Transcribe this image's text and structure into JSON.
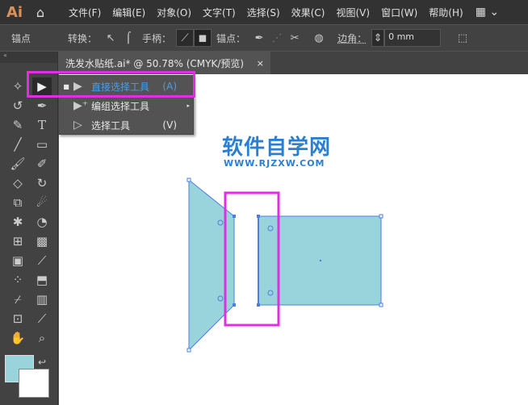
{
  "app": {
    "logo": "Ai"
  },
  "menu": [
    "文件(F)",
    "编辑(E)",
    "对象(O)",
    "文字(T)",
    "选择(S)",
    "效果(C)",
    "视图(V)",
    "窗口(W)",
    "帮助(H)"
  ],
  "control": {
    "anchor_label": "锚点",
    "convert_label": "转换：",
    "handles_label": "手柄：",
    "anchors_label": "锚点：",
    "corner_label": "边角：",
    "corner_value": "0 mm"
  },
  "document_tab": {
    "title": "洗发水贴纸.ai* @ 50.78% (CMYK/预览)",
    "close": "×"
  },
  "flyout": [
    {
      "label": "直接选择工具",
      "shortcut": "(A)",
      "active": true
    },
    {
      "label": "编组选择工具",
      "shortcut": ""
    },
    {
      "label": "选择工具",
      "shortcut": "(V)"
    }
  ],
  "watermark": {
    "title": "软件自学网",
    "url": "WWW.RJZXW.COM"
  },
  "colors": {
    "fill": "#99d3dc",
    "stroke": "#4a7fe0",
    "highlight": "#e12ee0"
  }
}
